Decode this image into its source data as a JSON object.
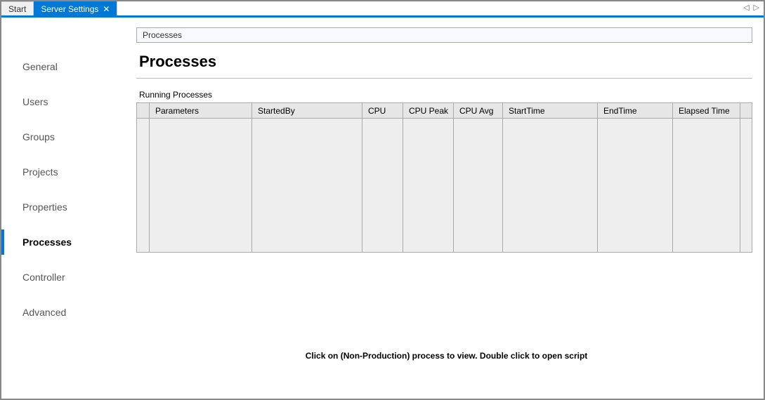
{
  "tabs": {
    "items": [
      {
        "label": "Start",
        "active": false
      },
      {
        "label": "Server Settings",
        "active": true
      }
    ]
  },
  "sidebar": {
    "items": [
      {
        "label": "General"
      },
      {
        "label": "Users"
      },
      {
        "label": "Groups"
      },
      {
        "label": "Projects"
      },
      {
        "label": "Properties"
      },
      {
        "label": "Processes",
        "active": true
      },
      {
        "label": "Controller"
      },
      {
        "label": "Advanced"
      }
    ]
  },
  "breadcrumb": "Processes",
  "page_title": "Processes",
  "section_label": "Running Processes",
  "columns": [
    "Parameters",
    "StartedBy",
    "CPU",
    "CPU Peak",
    "CPU Avg",
    "StartTime",
    "EndTime",
    "Elapsed Time"
  ],
  "rows": [],
  "hint": "Click on (Non-Production) process to view. Double click to open script"
}
